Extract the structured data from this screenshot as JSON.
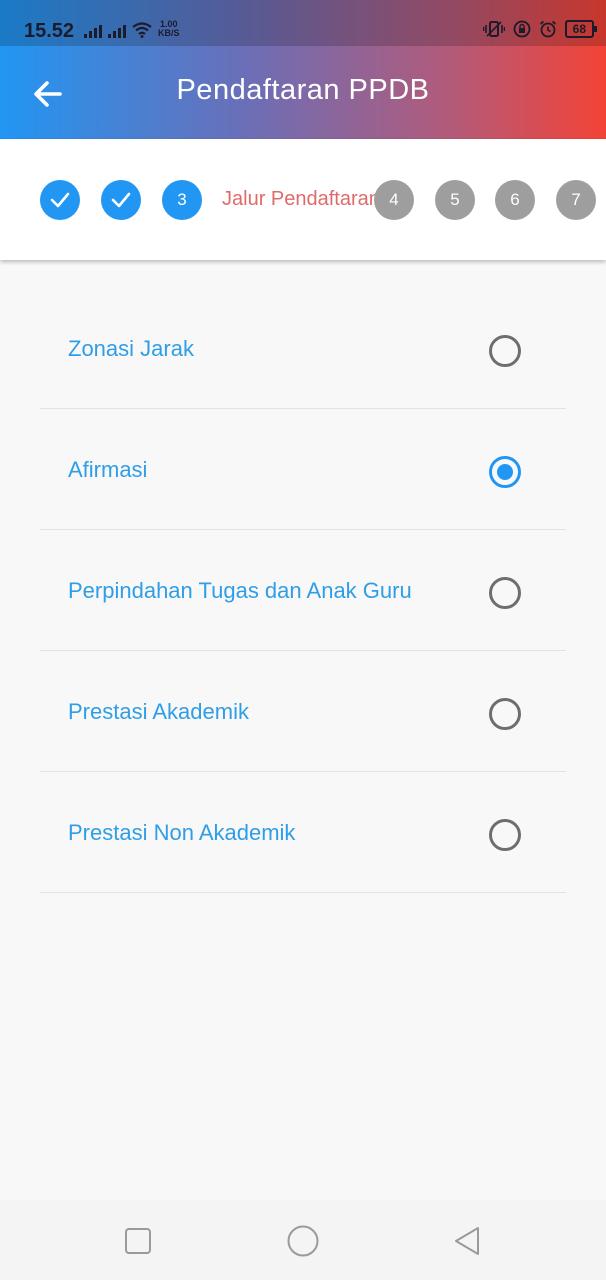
{
  "status_bar": {
    "time": "15.52",
    "net_speed_value": "1.00",
    "net_speed_unit": "KB/S",
    "battery": "68"
  },
  "app_bar": {
    "title": "Pendaftaran PPDB"
  },
  "stepper": {
    "steps": [
      {
        "number": "1",
        "state": "done"
      },
      {
        "number": "2",
        "state": "done"
      },
      {
        "number": "3",
        "state": "active"
      },
      {
        "number": "4",
        "state": "pending"
      },
      {
        "number": "5",
        "state": "pending"
      },
      {
        "number": "6",
        "state": "pending"
      },
      {
        "number": "7",
        "state": "pending"
      }
    ],
    "active_label": "Jalur Pendaftaran"
  },
  "options": [
    {
      "label": "Zonasi Jarak",
      "selected": false
    },
    {
      "label": "Afirmasi",
      "selected": true
    },
    {
      "label": "Perpindahan Tugas dan Anak Guru",
      "selected": false
    },
    {
      "label": "Prestasi Akademik",
      "selected": false
    },
    {
      "label": "Prestasi Non Akademik",
      "selected": false
    }
  ],
  "colors": {
    "primary": "#2196f3",
    "accent_red": "#f44336",
    "step_label": "#e06a6a",
    "pending_step": "#9e9e9e"
  },
  "icons": [
    "back-arrow-icon",
    "check-icon",
    "square-icon",
    "circle-icon",
    "triangle-back-icon"
  ]
}
